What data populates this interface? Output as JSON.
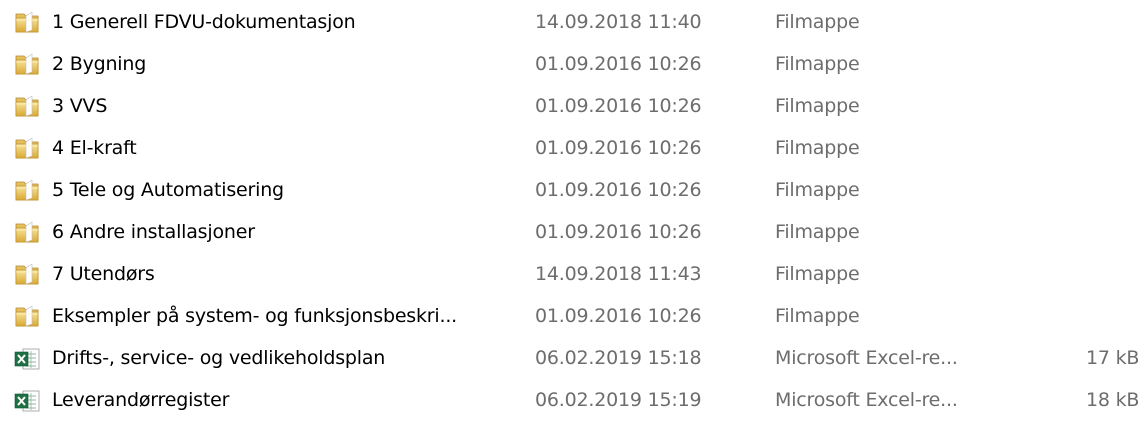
{
  "files": [
    {
      "name": "1 Generell FDVU-dokumentasjon",
      "modified": "14.09.2018 11:40",
      "type": "Filmappe",
      "size": "",
      "icon": "folder-icon"
    },
    {
      "name": "2 Bygning",
      "modified": "01.09.2016 10:26",
      "type": "Filmappe",
      "size": "",
      "icon": "folder-icon"
    },
    {
      "name": "3 VVS",
      "modified": "01.09.2016 10:26",
      "type": "Filmappe",
      "size": "",
      "icon": "folder-icon"
    },
    {
      "name": "4 El-kraft",
      "modified": "01.09.2016 10:26",
      "type": "Filmappe",
      "size": "",
      "icon": "folder-icon"
    },
    {
      "name": "5 Tele og Automatisering",
      "modified": "01.09.2016 10:26",
      "type": "Filmappe",
      "size": "",
      "icon": "folder-icon"
    },
    {
      "name": "6 Andre installasjoner",
      "modified": "01.09.2016 10:26",
      "type": "Filmappe",
      "size": "",
      "icon": "folder-icon"
    },
    {
      "name": "7 Utendørs",
      "modified": "14.09.2018 11:43",
      "type": "Filmappe",
      "size": "",
      "icon": "folder-icon"
    },
    {
      "name": "Eksempler på system- og funksjonsbeskri...",
      "modified": "01.09.2016 10:26",
      "type": "Filmappe",
      "size": "",
      "icon": "folder-icon"
    },
    {
      "name": "Drifts-, service- og vedlikeholdsplan",
      "modified": "06.02.2019 15:18",
      "type": "Microsoft Excel-re...",
      "size": "17 kB",
      "icon": "excel-file-icon"
    },
    {
      "name": "Leverandørregister",
      "modified": "06.02.2019 15:19",
      "type": "Microsoft Excel-re...",
      "size": "18 kB",
      "icon": "excel-file-icon"
    }
  ],
  "colors": {
    "name_text": "#000000",
    "detail_text": "#6d6d6d",
    "folder_body": "#e8c158",
    "excel_green": "#1e7145"
  }
}
